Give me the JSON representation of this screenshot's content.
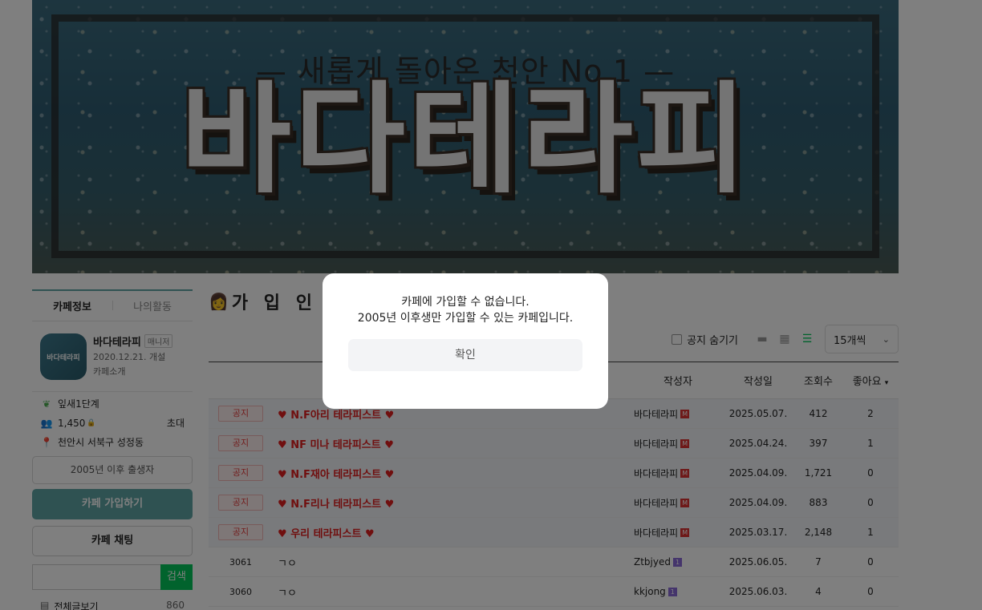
{
  "banner": {
    "subtitle": "— 새롭게 돌아온 천안 No.1 —",
    "title": "바다테라피"
  },
  "sidebar": {
    "tabs": [
      "카페정보",
      "나의활동"
    ],
    "cafe_name": "바다테라피",
    "thumb_label": "바다테라피",
    "manager_badge": "매니저",
    "founded": "2020.12.21. 개설",
    "intro_link": "카페소개",
    "level": "잎새1단계",
    "members": "1,450",
    "invite": "초대",
    "location": "천안시 서북구 성정동",
    "birth_restriction": "2005년 이후 출생자",
    "join_button": "카페 가입하기",
    "chat_button": "카페 채팅",
    "search_button": "검색",
    "all_posts": "전체글보기",
    "all_posts_count": "860"
  },
  "main": {
    "board_title": "가 입 인 사",
    "board_emoji": "👩",
    "hide_notice": "공지 숨기기",
    "per_page": "15개씩",
    "columns": {
      "author": "작성자",
      "date": "작성일",
      "views": "조회수",
      "likes": "좋아요"
    },
    "notice_tag": "공지",
    "notices": [
      {
        "title": "N.F아리 테라피스트",
        "author": "바다테라피",
        "date": "2025.05.07.",
        "views": "412",
        "likes": "2"
      },
      {
        "title": "NF 미나 테라피스트",
        "author": "바다테라피",
        "date": "2025.04.24.",
        "views": "397",
        "likes": "1"
      },
      {
        "title": "N.F재아 테라피스트",
        "author": "바다테라피",
        "date": "2025.04.09.",
        "views": "1,721",
        "likes": "0"
      },
      {
        "title": "N.F리나 테라피스트",
        "author": "바다테라피",
        "date": "2025.04.09.",
        "views": "883",
        "likes": "0"
      },
      {
        "title": "우리 테라피스트",
        "author": "바다테라피",
        "date": "2025.03.17.",
        "views": "2,148",
        "likes": "1"
      }
    ],
    "posts": [
      {
        "no": "3061",
        "title": "ㄱㅇ",
        "author": "Ztbjyed",
        "date": "2025.06.05.",
        "views": "7",
        "likes": "0"
      },
      {
        "no": "3060",
        "title": "ㄱㅇ",
        "author": "kkjong",
        "date": "2025.06.03.",
        "views": "4",
        "likes": "0"
      }
    ]
  },
  "modal": {
    "line1": "카페에 가입할 수 없습니다.",
    "line2": "2005년 이후생만 가입할 수 있는 카페입니다.",
    "confirm": "확인"
  },
  "colors": {
    "accent": "#5ea4a4",
    "search_green": "#03c75a",
    "notice_red": "#e01e1e"
  }
}
